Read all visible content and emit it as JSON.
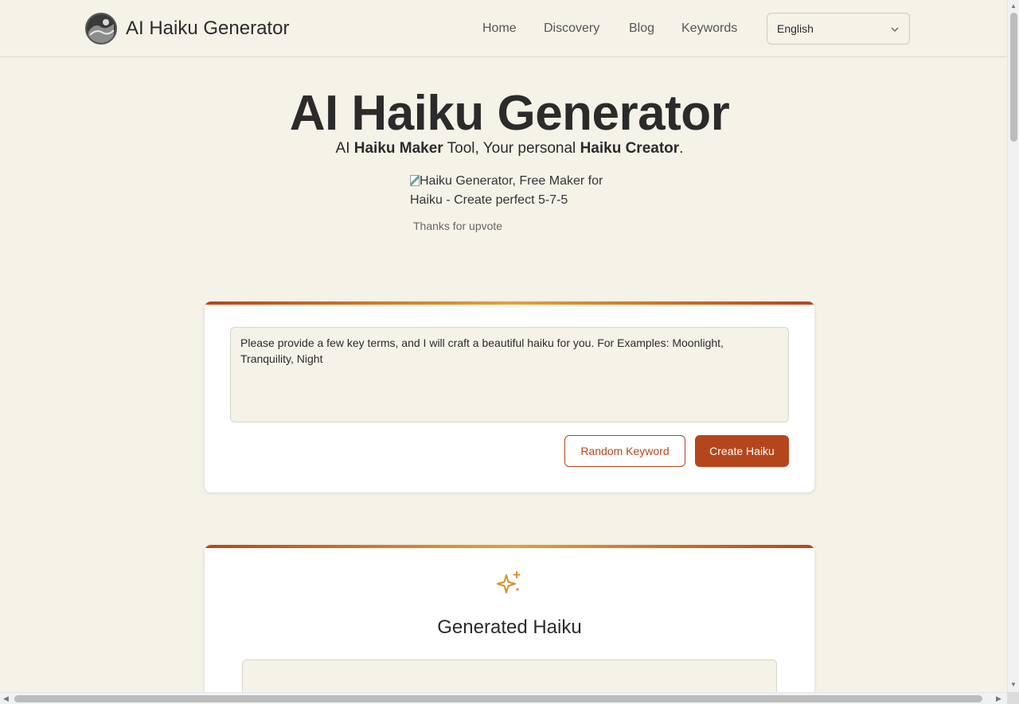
{
  "header": {
    "brand": "AI Haiku Generator",
    "nav": [
      {
        "label": "Home"
      },
      {
        "label": "Discovery"
      },
      {
        "label": "Blog"
      },
      {
        "label": "Keywords"
      }
    ],
    "language": "English"
  },
  "hero": {
    "title": "AI Haiku Generator",
    "sub_pre": "AI ",
    "sub_b1": "Haiku Maker",
    "sub_mid": " Tool, Your personal ",
    "sub_b2": "Haiku Creator",
    "sub_end": ".",
    "image_alt": "Haiku Generator, Free Maker for Haiku - Create perfect 5-7-5",
    "upvote": "Thanks for upvote"
  },
  "prompt_card": {
    "placeholder": "Please provide a few key terms, and I will craft a beautiful haiku for you. For Examples: Moonlight, Tranquility, Night",
    "random_button": "Random Keyword",
    "create_button": "Create Haiku"
  },
  "result_card": {
    "icon": "sparkle-icon",
    "title": "Generated Haiku"
  },
  "colors": {
    "accent": "#b5461b",
    "gold": "#e3a13a",
    "background": "#f5f2e8"
  }
}
